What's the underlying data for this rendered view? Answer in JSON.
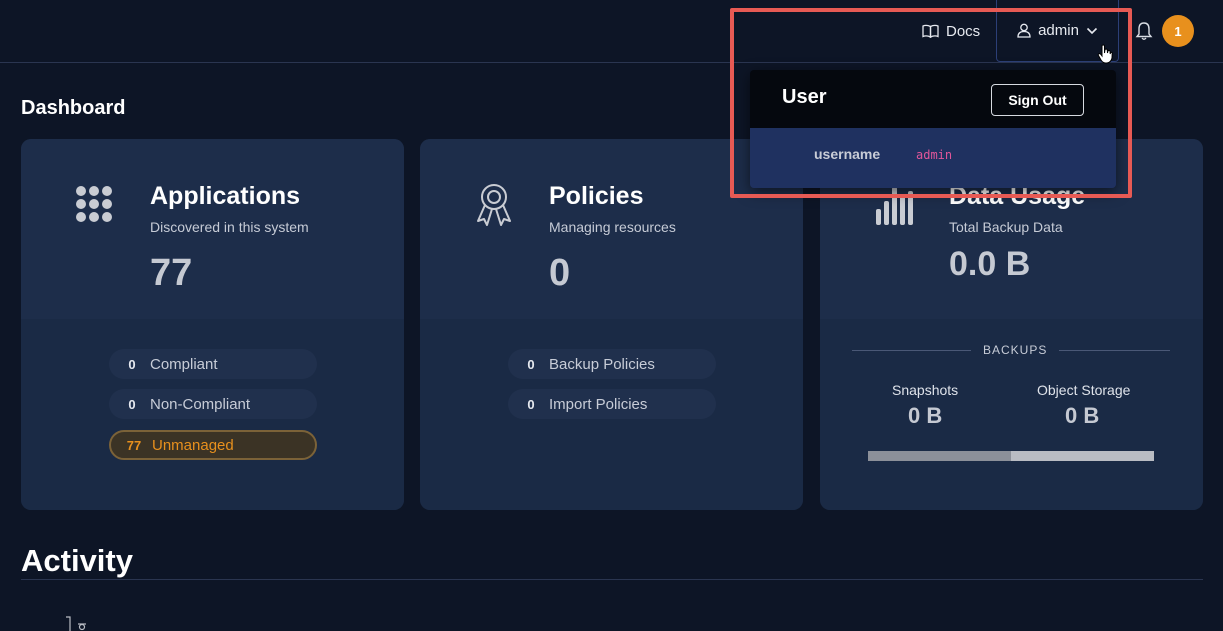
{
  "header": {
    "docs_label": "Docs",
    "user_label": "admin",
    "notification_count": "1"
  },
  "dashboard": {
    "title": "Dashboard",
    "cards": {
      "applications": {
        "title": "Applications",
        "subtitle": "Discovered in this system",
        "value": "77",
        "icon": "apps-grid-icon",
        "pills": [
          {
            "count": "0",
            "label": "Compliant"
          },
          {
            "count": "0",
            "label": "Non-Compliant"
          },
          {
            "count": "77",
            "label": "Unmanaged"
          }
        ]
      },
      "policies": {
        "title": "Policies",
        "subtitle": "Managing resources",
        "value": "0",
        "icon": "award-ribbon-icon",
        "pills": [
          {
            "count": "0",
            "label": "Backup Policies"
          },
          {
            "count": "0",
            "label": "Import Policies"
          }
        ]
      },
      "data_usage": {
        "title": "Data Usage",
        "subtitle": "Total Backup Data",
        "value": "0.0 B",
        "icon": "bar-chart-icon",
        "backups_label": "BACKUPS",
        "snapshots_label": "Snapshots",
        "snapshots_value": "0 B",
        "object_storage_label": "Object Storage",
        "object_storage_value": "0 B",
        "snapshots_share": 0.5
      }
    }
  },
  "activity": {
    "title": "Activity"
  },
  "user_menu": {
    "title": "User",
    "sign_out_label": "Sign Out",
    "username_key": "username",
    "username_value": "admin"
  },
  "colors": {
    "background": "#0d1526",
    "card": "#1d2d4a",
    "warning": "#e8901d",
    "highlight": "#e75a54",
    "username_value": "#e0569a"
  }
}
